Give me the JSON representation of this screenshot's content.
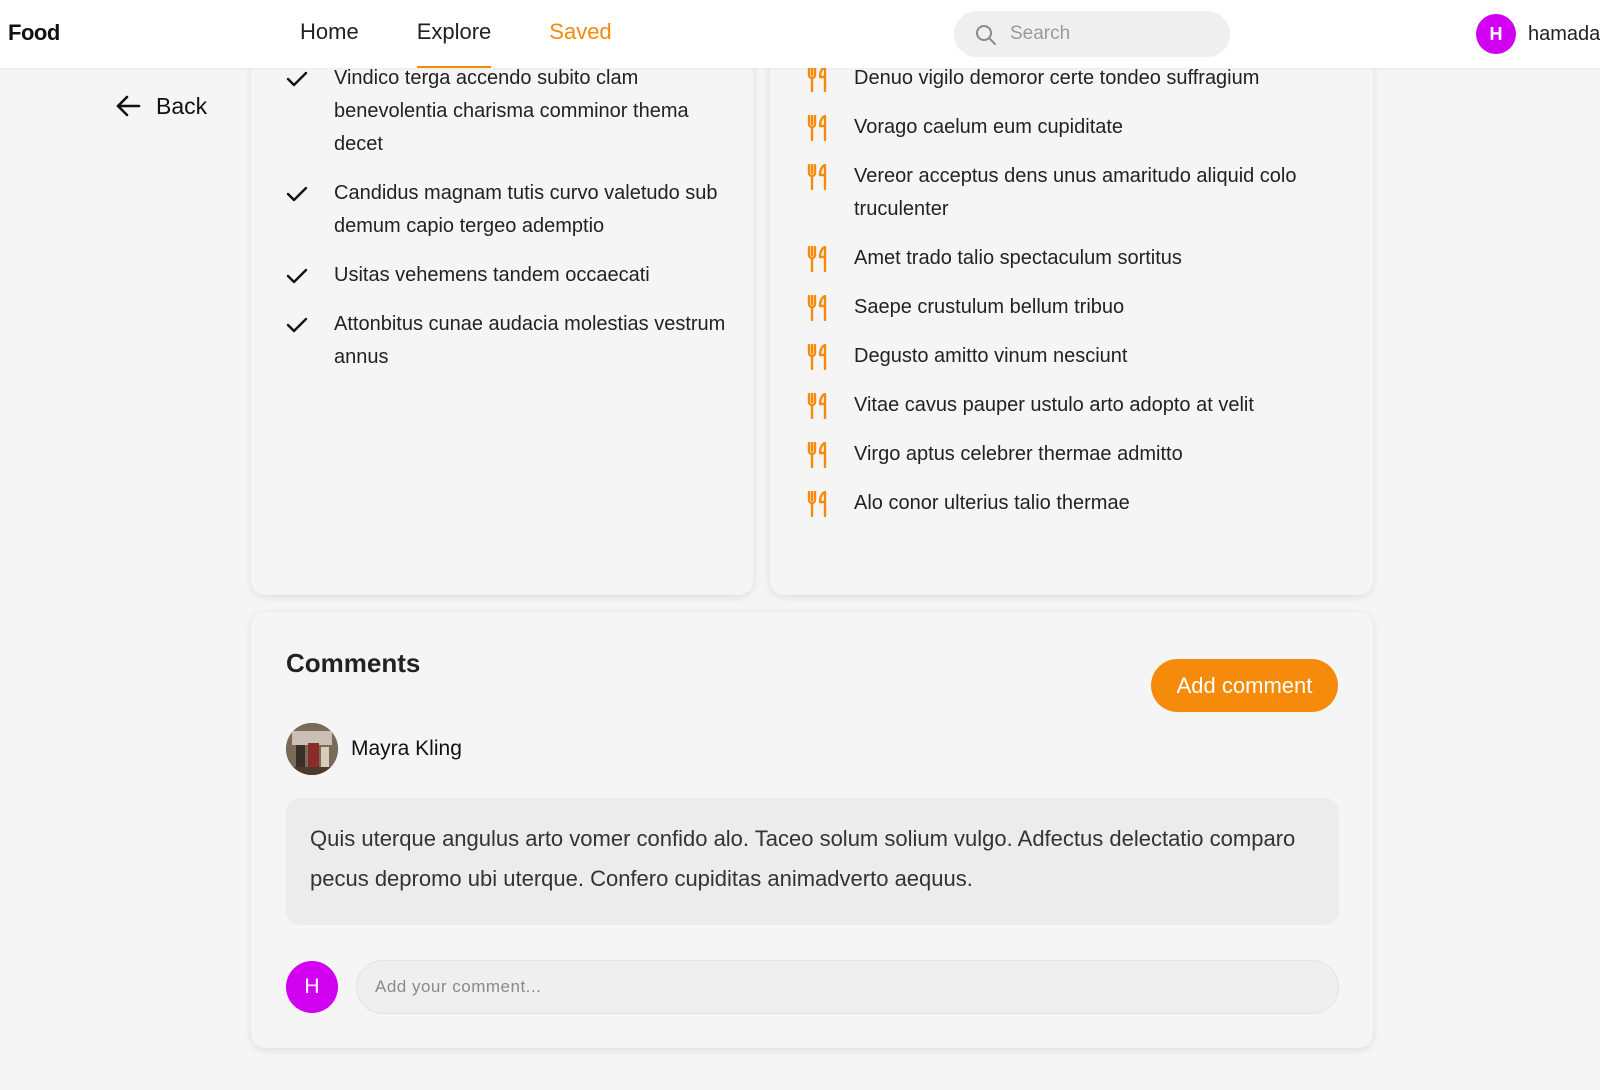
{
  "header": {
    "logo": "Food",
    "nav": [
      {
        "label": "Home"
      },
      {
        "label": "Explore"
      },
      {
        "label": "Saved"
      }
    ],
    "search": {
      "placeholder": "Search"
    },
    "user": {
      "initial": "H",
      "name": "hamada"
    }
  },
  "back": {
    "label": "Back"
  },
  "steps": [
    "Vindico terga accendo subito clam benevolentia charisma comminor thema decet",
    "Candidus magnam tutis curvo valetudo sub demum capio tergeo ademptio",
    "Usitas vehemens tandem occaecati",
    "Attonbitus cunae audacia molestias vestrum annus"
  ],
  "ingredients": [
    "Denuo vigilo demoror certe tondeo suffragium",
    "Vorago caelum eum cupiditate",
    "Vereor acceptus dens unus amaritudo aliquid colo truculenter",
    "Amet trado talio spectaculum sortitus",
    "Saepe crustulum bellum tribuo",
    "Degusto amitto vinum nesciunt",
    "Vitae cavus pauper ustulo arto adopto at velit",
    "Virgo aptus celebrer thermae admitto",
    "Alo conor ulterius talio thermae"
  ],
  "comments": {
    "title": "Comments",
    "add_button": "Add comment",
    "items": [
      {
        "author": "Mayra Kling",
        "text": "Quis uterque angulus arto vomer confido alo. Taceo solum solium vulgo. Adfectus delectatio comparo pecus depromo ubi uterque. Confero cupiditas animadverto aequus."
      }
    ],
    "reply": {
      "initial": "H",
      "placeholder": "Add your comment..."
    }
  },
  "colors": {
    "accent": "#f58a0b",
    "avatar": "#d100f0"
  },
  "icons": {
    "search": "search-icon",
    "back": "arrow-left-icon",
    "step": "check-icon",
    "ingredient": "utensils-icon"
  }
}
